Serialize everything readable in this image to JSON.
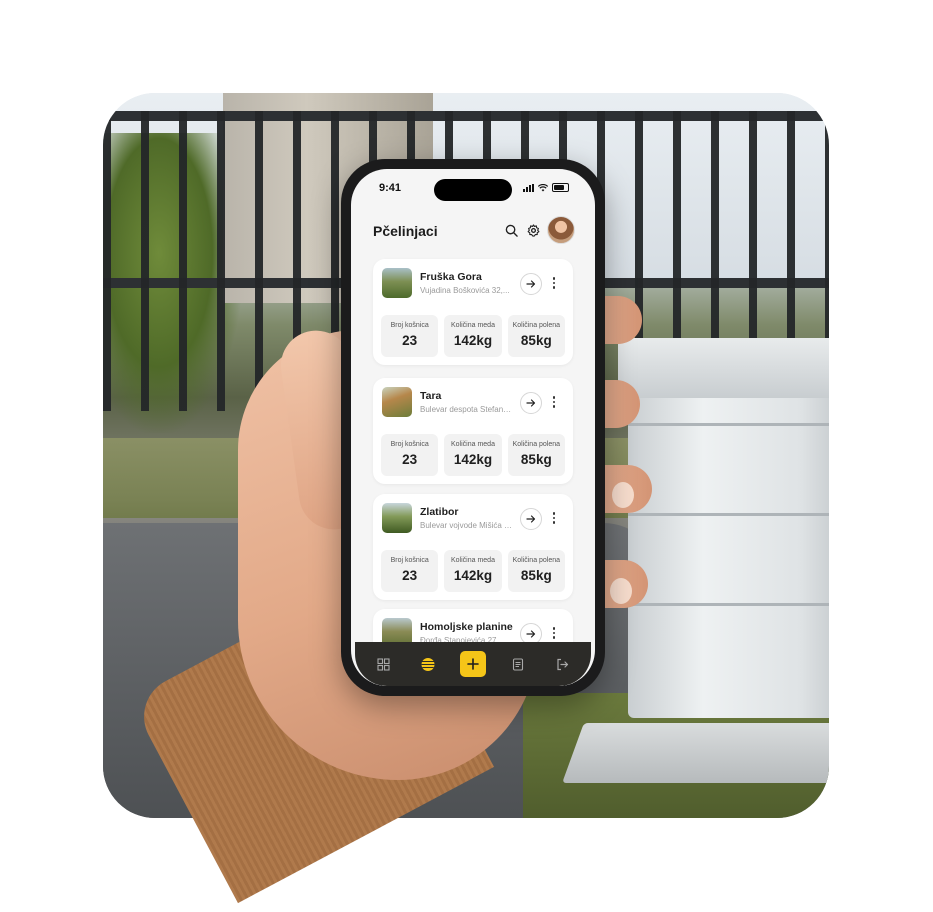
{
  "status_bar": {
    "time": "9:41"
  },
  "header": {
    "title": "Pčelinjaci"
  },
  "colors": {
    "accent": "#F5C518",
    "tabbar": "#2C2B28",
    "card": "#FFFFFF",
    "screen": "#F5F5F5"
  },
  "icons": {
    "header": [
      "search-icon",
      "gear-icon"
    ],
    "card": [
      "arrow-right-icon",
      "more-vertical-icon"
    ],
    "tabs": [
      "dashboard-grid-icon",
      "hive-icon",
      "plus-icon",
      "document-icon",
      "logout-icon"
    ]
  },
  "apiaries": [
    {
      "name": "Fruška Gora",
      "address": "Vujadina Boškovića 32,...",
      "stats": [
        {
          "label": "Broj košnica",
          "value": "23"
        },
        {
          "label": "Količina meda",
          "value": "142kg"
        },
        {
          "label": "Količina polena",
          "value": "85kg"
        }
      ]
    },
    {
      "name": "Tara",
      "address": "Bulevar despota Stefana...",
      "stats": [
        {
          "label": "Broj košnica",
          "value": "23"
        },
        {
          "label": "Količina meda",
          "value": "142kg"
        },
        {
          "label": "Količina polena",
          "value": "85kg"
        }
      ]
    },
    {
      "name": "Zlatibor",
      "address": "Bulevar vojvode Mišića 1...",
      "stats": [
        {
          "label": "Broj košnica",
          "value": "23"
        },
        {
          "label": "Količina meda",
          "value": "142kg"
        },
        {
          "label": "Količina polena",
          "value": "85kg"
        }
      ]
    },
    {
      "name": "Homoljske planine",
      "address": "Đorđa Stanojevića 27..."
    }
  ]
}
